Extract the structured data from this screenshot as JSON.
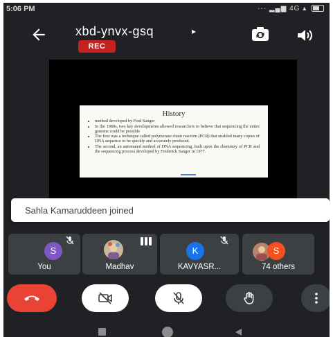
{
  "status_bar": {
    "time": "5:06 PM",
    "network": "4G"
  },
  "header": {
    "meeting_code": "xbd-ynvx-gsq",
    "caret": "▸",
    "rec_label": "REC"
  },
  "slide": {
    "title": "History",
    "bullets": [
      "method developed by Fred Sanger",
      "In the 1980s, two key developments allowed researchers to believe that sequencing the entire genome could be possible",
      "The first was a technique called polymerase chain reaction (PCR) that enabled many copies of DNA sequence to be quickly and accurately produced.",
      "The second, an automated method of DNA sequencing, built upon the chemistry of PCR and the sequencing process developed by Frederick Sanger in 1977."
    ]
  },
  "toast": {
    "text": "Sahla Kamaruddeen joined"
  },
  "participants": [
    {
      "label": "You",
      "initial": "S",
      "color": "#7e57c2"
    },
    {
      "label": "Madhav",
      "initial": "",
      "color": ""
    },
    {
      "label": "KAVYASR...",
      "initial": "K",
      "color": "#1a73e8"
    },
    {
      "label": "74 others",
      "initial": "S",
      "color": "#f4511e"
    }
  ],
  "colors": {
    "end_call": "#ea4335",
    "rec": "#c5221f",
    "background": "#1f2124",
    "tile": "#3c4043"
  },
  "icons": {
    "back": "arrow-left-icon",
    "switch_camera": "switch-camera-icon",
    "speaker": "speaker-icon",
    "end_call": "end-call-icon",
    "camera_off": "camera-off-icon",
    "mic_off": "mic-off-icon",
    "raise_hand": "hand-icon",
    "more": "more-vertical-icon"
  }
}
